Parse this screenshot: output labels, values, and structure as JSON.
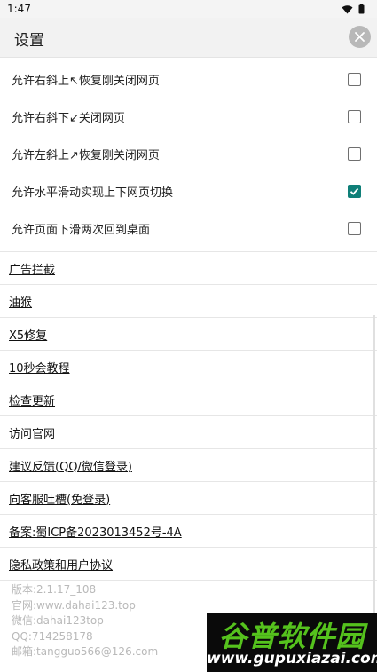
{
  "status": {
    "time": "1:47"
  },
  "header": {
    "title": "设置"
  },
  "checks": [
    {
      "label": "允许右斜上↖恢复刚关闭网页",
      "checked": false
    },
    {
      "label": "允许右斜下↙关闭网页",
      "checked": false
    },
    {
      "label": "允许左斜上↗恢复刚关闭网页",
      "checked": false
    },
    {
      "label": "允许水平滑动实现上下网页切换",
      "checked": true
    },
    {
      "label": "允许页面下滑两次回到桌面",
      "checked": false
    }
  ],
  "menu": [
    "广告拦截",
    "油猴",
    "X5修复",
    "10秒会教程",
    "检查更新",
    "访问官网",
    "建议反馈(QQ/微信登录)",
    "向客服吐槽(免登录)",
    "备案:蜀ICP备2023013452号-4A",
    "隐私政策和用户协议"
  ],
  "info": {
    "version": "版本:2.1.17_108",
    "website": "官网:www.dahai123.top",
    "wechat": "微信:dahai123top",
    "qq": "QQ:714258178",
    "email": "邮箱:tangguo566@126.com"
  },
  "watermark": {
    "title": "谷普软件园",
    "url": "www.gupuxiazai.com"
  },
  "colors": {
    "accent": "#0f7f78",
    "header_bg": "#f2f2f2",
    "watermark_green": "#55c21d"
  }
}
